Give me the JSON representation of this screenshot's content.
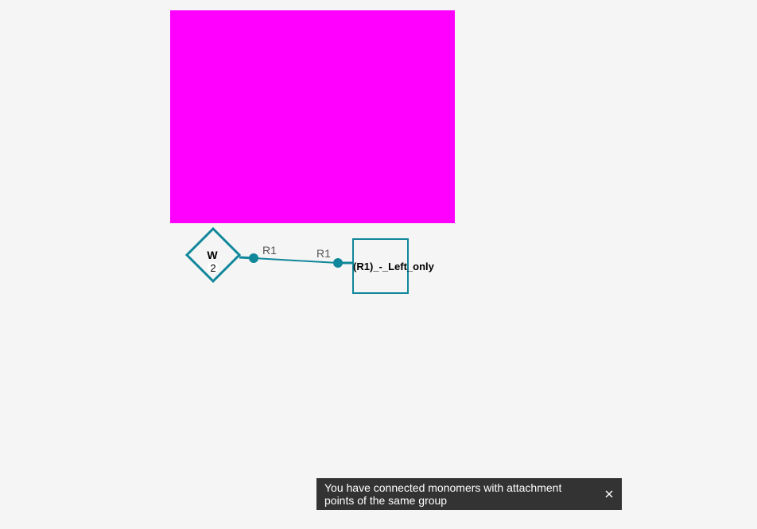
{
  "canvas": {
    "background_color": "#f5f5f5",
    "highlight_color": "#ff00ff",
    "monomer_color": "#10879a",
    "bond_color": "#10879a"
  },
  "monomers": [
    {
      "shape": "diamond",
      "symbol": "W",
      "number": "2"
    },
    {
      "shape": "square",
      "symbol": "(R1)_-_Left_only"
    }
  ],
  "bond": {
    "left_label": "R1",
    "right_label": "R1"
  },
  "toast": {
    "message": "You have connected monomers with attachment points of the same group",
    "background_color": "#333333",
    "text_color": "#ffffff",
    "close_icon": "close-icon"
  }
}
